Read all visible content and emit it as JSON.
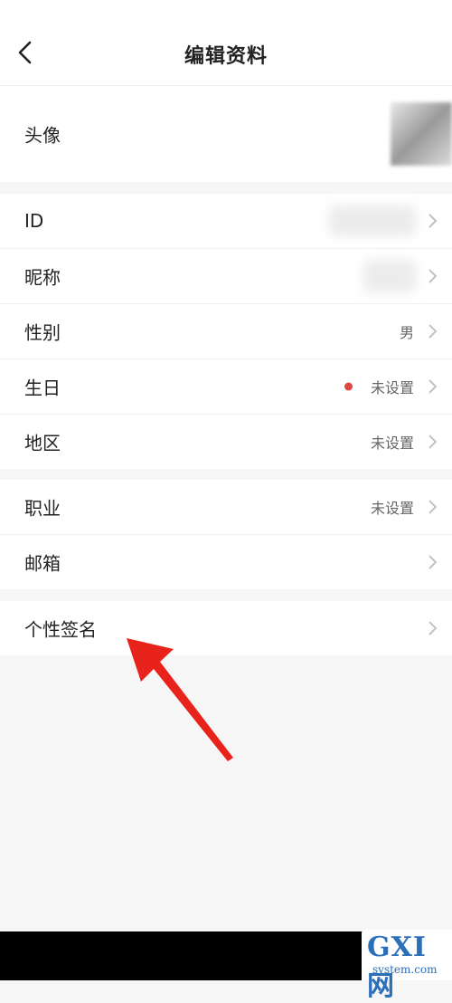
{
  "header": {
    "title": "编辑资料",
    "back_icon": "chevron-left-icon"
  },
  "avatar_row": {
    "label": "头像"
  },
  "group_basic": [
    {
      "label": "ID",
      "value": ""
    },
    {
      "label": "昵称",
      "value": ""
    },
    {
      "label": "性别",
      "value": "男"
    },
    {
      "label": "生日",
      "value": "未设置"
    },
    {
      "label": "地区",
      "value": "未设置"
    }
  ],
  "group_work": [
    {
      "label": "职业",
      "value": "未设置"
    },
    {
      "label": "邮箱",
      "value": ""
    }
  ],
  "group_signature": [
    {
      "label": "个性签名",
      "value": ""
    }
  ],
  "colors": {
    "accent_dot": "#e0463f",
    "annotation_arrow": "#e8231b",
    "background": "#f6f6f6"
  },
  "watermark": {
    "main": "GXI网",
    "sub": "system.com"
  }
}
